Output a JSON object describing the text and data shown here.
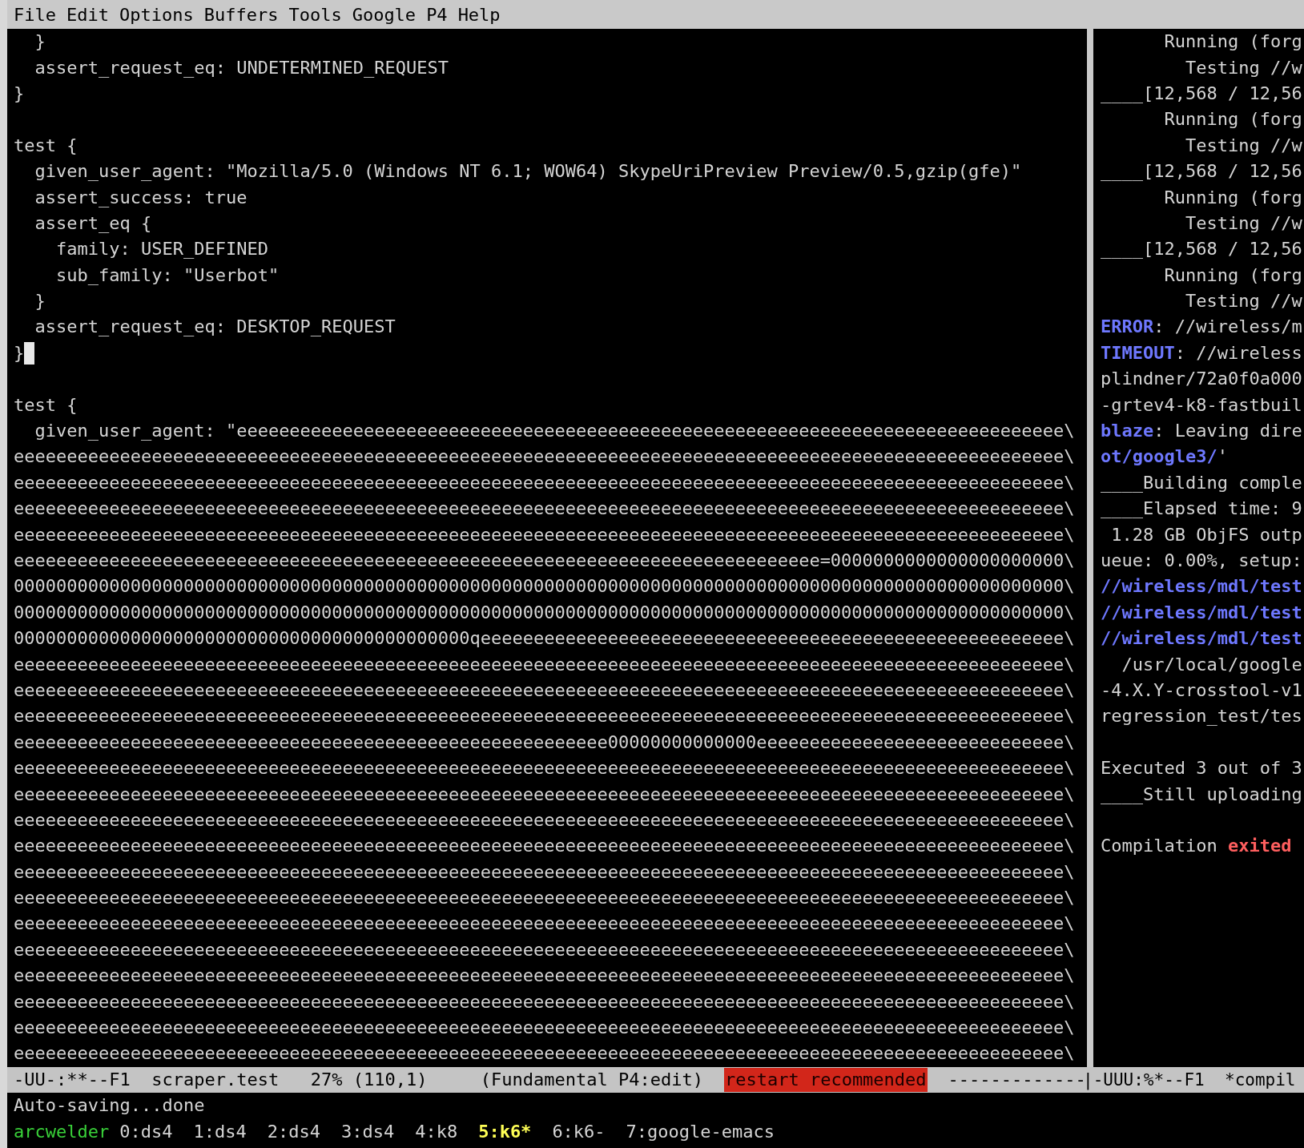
{
  "menu_bar": {
    "items": [
      "File",
      "Edit",
      "Options",
      "Buffers",
      "Tools",
      "Google",
      "P4",
      "Help"
    ]
  },
  "left_pane": {
    "lines": [
      {
        "kind": "code",
        "text": "  }",
        "cursor": false
      },
      {
        "kind": "code",
        "text": "  assert_request_eq: UNDETERMINED_REQUEST",
        "cursor": false
      },
      {
        "kind": "code",
        "text": "}",
        "cursor": false
      },
      {
        "kind": "blank"
      },
      {
        "kind": "code",
        "text": "test {",
        "cursor": false
      },
      {
        "kind": "code",
        "text": "  given_user_agent: \"Mozilla/5.0 (Windows NT 6.1; WOW64) SkypeUriPreview Preview/0.5,gzip(gfe)\"",
        "cursor": false
      },
      {
        "kind": "code",
        "text": "  assert_success: true",
        "cursor": false
      },
      {
        "kind": "code",
        "text": "  assert_eq {",
        "cursor": false
      },
      {
        "kind": "code",
        "text": "    family: USER_DEFINED",
        "cursor": false
      },
      {
        "kind": "code",
        "text": "    sub_family: \"Userbot\"",
        "cursor": false
      },
      {
        "kind": "code",
        "text": "  }",
        "cursor": false
      },
      {
        "kind": "code",
        "text": "  assert_request_eq: DESKTOP_REQUEST",
        "cursor": false
      },
      {
        "kind": "code",
        "text": "}",
        "cursor": true
      },
      {
        "kind": "blank"
      },
      {
        "kind": "code",
        "text": "test {",
        "cursor": false
      },
      {
        "kind": "code",
        "text": "  given_user_agent: \"eeeeeeeeeeeeeeeeeeeeeeeeeeeeeeeeeeeeeeeeeeeeeeeeeeeeeeeeeeeeeeeeeeeeeeeeeeeeee\\",
        "cursor": false
      },
      {
        "kind": "code",
        "text": "eeeeeeeeeeeeeeeeeeeeeeeeeeeeeeeeeeeeeeeeeeeeeeeeeeeeeeeeeeeeeeeeeeeeeeeeeeeeeeeeeeeeeeeeeeeeeeeeeee\\",
        "cursor": false
      },
      {
        "kind": "code",
        "text": "eeeeeeeeeeeeeeeeeeeeeeeeeeeeeeeeeeeeeeeeeeeeeeeeeeeeeeeeeeeeeeeeeeeeeeeeeeeeeeeeeeeeeeeeeeeeeeeeeee\\",
        "cursor": false
      },
      {
        "kind": "code",
        "text": "eeeeeeeeeeeeeeeeeeeeeeeeeeeeeeeeeeeeeeeeeeeeeeeeeeeeeeeeeeeeeeeeeeeeeeeeeeeeeeeeeeeeeeeeeeeeeeeeeee\\",
        "cursor": false
      },
      {
        "kind": "code",
        "text": "eeeeeeeeeeeeeeeeeeeeeeeeeeeeeeeeeeeeeeeeeeeeeeeeeeeeeeeeeeeeeeeeeeeeeeeeeeeeeeeeeeeeeeeeeeeeeeeeeee\\",
        "cursor": false
      },
      {
        "kind": "code",
        "text": "eeeeeeeeeeeeeeeeeeeeeeeeeeeeeeeeeeeeeeeeeeeeeeeeeeeeeeeeeeeeeeeeeeeeeeeeeeee=0000000000000000000000\\",
        "cursor": false
      },
      {
        "kind": "code",
        "text": "000000000000000000000000000000000000000000000000000000000000000000000000000000000000000000000000000\\",
        "cursor": false
      },
      {
        "kind": "code",
        "text": "000000000000000000000000000000000000000000000000000000000000000000000000000000000000000000000000000\\",
        "cursor": false
      },
      {
        "kind": "code",
        "text": "0000000000000000000000000000000000000000000qeeeeeeeeeeeeeeeeeeeeeeeeeeeeeeeeeeeeeeeeeeeeeeeeeeeeeee\\",
        "cursor": false
      },
      {
        "kind": "code",
        "text": "eeeeeeeeeeeeeeeeeeeeeeeeeeeeeeeeeeeeeeeeeeeeeeeeeeeeeeeeeeeeeeeeeeeeeeeeeeeeeeeeeeeeeeeeeeeeeeeeeee\\",
        "cursor": false
      },
      {
        "kind": "code",
        "text": "eeeeeeeeeeeeeeeeeeeeeeeeeeeeeeeeeeeeeeeeeeeeeeeeeeeeeeeeeeeeeeeeeeeeeeeeeeeeeeeeeeeeeeeeeeeeeeeeeee\\",
        "cursor": false
      },
      {
        "kind": "code",
        "text": "eeeeeeeeeeeeeeeeeeeeeeeeeeeeeeeeeeeeeeeeeeeeeeeeeeeeeeeeeeeeeeeeeeeeeeeeeeeeeeeeeeeeeeeeeeeeeeeeeee\\",
        "cursor": false
      },
      {
        "kind": "code",
        "text": "eeeeeeeeeeeeeeeeeeeeeeeeeeeeeeeeeeeeeeeeeeeeeeeeeeeeeeee00000000000000eeeeeeeeeeeeeeeeeeeeeeeeeeeee\\",
        "cursor": false
      },
      {
        "kind": "code",
        "text": "eeeeeeeeeeeeeeeeeeeeeeeeeeeeeeeeeeeeeeeeeeeeeeeeeeeeeeeeeeeeeeeeeeeeeeeeeeeeeeeeeeeeeeeeeeeeeeeeeee\\",
        "cursor": false
      },
      {
        "kind": "code",
        "text": "eeeeeeeeeeeeeeeeeeeeeeeeeeeeeeeeeeeeeeeeeeeeeeeeeeeeeeeeeeeeeeeeeeeeeeeeeeeeeeeeeeeeeeeeeeeeeeeeeee\\",
        "cursor": false
      },
      {
        "kind": "code",
        "text": "eeeeeeeeeeeeeeeeeeeeeeeeeeeeeeeeeeeeeeeeeeeeeeeeeeeeeeeeeeeeeeeeeeeeeeeeeeeeeeeeeeeeeeeeeeeeeeeeeee\\",
        "cursor": false
      },
      {
        "kind": "code",
        "text": "eeeeeeeeeeeeeeeeeeeeeeeeeeeeeeeeeeeeeeeeeeeeeeeeeeeeeeeeeeeeeeeeeeeeeeeeeeeeeeeeeeeeeeeeeeeeeeeeeee\\",
        "cursor": false
      },
      {
        "kind": "code",
        "text": "eeeeeeeeeeeeeeeeeeeeeeeeeeeeeeeeeeeeeeeeeeeeeeeeeeeeeeeeeeeeeeeeeeeeeeeeeeeeeeeeeeeeeeeeeeeeeeeeeee\\",
        "cursor": false
      },
      {
        "kind": "code",
        "text": "eeeeeeeeeeeeeeeeeeeeeeeeeeeeeeeeeeeeeeeeeeeeeeeeeeeeeeeeeeeeeeeeeeeeeeeeeeeeeeeeeeeeeeeeeeeeeeeeeee\\",
        "cursor": false
      },
      {
        "kind": "code",
        "text": "eeeeeeeeeeeeeeeeeeeeeeeeeeeeeeeeeeeeeeeeeeeeeeeeeeeeeeeeeeeeeeeeeeeeeeeeeeeeeeeeeeeeeeeeeeeeeeeeeee\\",
        "cursor": false
      },
      {
        "kind": "code",
        "text": "eeeeeeeeeeeeeeeeeeeeeeeeeeeeeeeeeeeeeeeeeeeeeeeeeeeeeeeeeeeeeeeeeeeeeeeeeeeeeeeeeeeeeeeeeeeeeeeeeee\\",
        "cursor": false
      },
      {
        "kind": "code",
        "text": "eeeeeeeeeeeeeeeeeeeeeeeeeeeeeeeeeeeeeeeeeeeeeeeeeeeeeeeeeeeeeeeeeeeeeeeeeeeeeeeeeeeeeeeeeeeeeeeeeee\\",
        "cursor": false
      },
      {
        "kind": "code",
        "text": "eeeeeeeeeeeeeeeeeeeeeeeeeeeeeeeeeeeeeeeeeeeeeeeeeeeeeeeeeeeeeeeeeeeeeeeeeeeeeeeeeeeeeeeeeeeeeeeeeee\\",
        "cursor": false
      },
      {
        "kind": "code",
        "text": "eeeeeeeeeeeeeeeeeeeeeeeeeeeeeeeeeeeeeeeeeeeeeeeeeeeeeeeeeeeeeeeeeeeeeeeeeeeeeeeeeeeeeeeeeeeeeeeeeee\\",
        "cursor": false
      },
      {
        "kind": "code",
        "text": "eeeeeeeeeeeeeeeeeeeeeeeeeeeeeeeeeeeeeeeeeeeeeeeeeeeeeeeeeeeeeeeeeeeeeeeeeeeeeeeeeeeeeeeeeeeeeeeeeee\\",
        "cursor": false
      }
    ]
  },
  "right_pane": {
    "lines": [
      {
        "kind": "output",
        "segments": [
          {
            "kind": "plain",
            "text": "      Running (forg"
          }
        ]
      },
      {
        "kind": "output",
        "segments": [
          {
            "kind": "plain",
            "text": "        Testing //w"
          }
        ]
      },
      {
        "kind": "output",
        "segments": [
          {
            "kind": "plain",
            "text": "____[12,568 / 12,56"
          }
        ]
      },
      {
        "kind": "output",
        "segments": [
          {
            "kind": "plain",
            "text": "      Running (forg"
          }
        ]
      },
      {
        "kind": "output",
        "segments": [
          {
            "kind": "plain",
            "text": "        Testing //w"
          }
        ]
      },
      {
        "kind": "output",
        "segments": [
          {
            "kind": "plain",
            "text": "____[12,568 / 12,56"
          }
        ]
      },
      {
        "kind": "output",
        "segments": [
          {
            "kind": "plain",
            "text": "      Running (forg"
          }
        ]
      },
      {
        "kind": "output",
        "segments": [
          {
            "kind": "plain",
            "text": "        Testing //w"
          }
        ]
      },
      {
        "kind": "output",
        "segments": [
          {
            "kind": "plain",
            "text": "____[12,568 / 12,56"
          }
        ]
      },
      {
        "kind": "output",
        "segments": [
          {
            "kind": "plain",
            "text": "      Running (forg"
          }
        ]
      },
      {
        "kind": "output",
        "segments": [
          {
            "kind": "plain",
            "text": "        Testing //w"
          }
        ]
      },
      {
        "kind": "output",
        "segments": [
          {
            "kind": "link",
            "text": "ERROR"
          },
          {
            "kind": "plain",
            "text": ": //wireless/m"
          }
        ]
      },
      {
        "kind": "output",
        "segments": [
          {
            "kind": "link",
            "text": "TIMEOUT"
          },
          {
            "kind": "plain",
            "text": ": //wireless"
          }
        ]
      },
      {
        "kind": "output",
        "segments": [
          {
            "kind": "plain",
            "text": "plindner/72a0f0a000"
          }
        ]
      },
      {
        "kind": "output",
        "segments": [
          {
            "kind": "plain",
            "text": "-grtev4-k8-fastbuil"
          }
        ]
      },
      {
        "kind": "output",
        "segments": [
          {
            "kind": "link",
            "text": "blaze"
          },
          {
            "kind": "plain",
            "text": ": Leaving dire"
          }
        ]
      },
      {
        "kind": "output",
        "segments": [
          {
            "kind": "link",
            "text": "ot/google3/"
          },
          {
            "kind": "plain",
            "text": "'"
          }
        ]
      },
      {
        "kind": "output",
        "segments": [
          {
            "kind": "plain",
            "text": "____Building comple"
          }
        ]
      },
      {
        "kind": "output",
        "segments": [
          {
            "kind": "plain",
            "text": "____Elapsed time: 9"
          }
        ]
      },
      {
        "kind": "output",
        "segments": [
          {
            "kind": "plain",
            "text": " 1.28 GB ObjFS outp"
          }
        ]
      },
      {
        "kind": "output",
        "segments": [
          {
            "kind": "plain",
            "text": "ueue: 0.00%, setup:"
          }
        ]
      },
      {
        "kind": "output",
        "segments": [
          {
            "kind": "link",
            "text": "//wireless/mdl/test"
          }
        ]
      },
      {
        "kind": "output",
        "segments": [
          {
            "kind": "link",
            "text": "//wireless/mdl/test"
          }
        ]
      },
      {
        "kind": "output",
        "segments": [
          {
            "kind": "link",
            "text": "//wireless/mdl/test"
          }
        ]
      },
      {
        "kind": "output",
        "segments": [
          {
            "kind": "plain",
            "text": "  /usr/local/google"
          }
        ]
      },
      {
        "kind": "output",
        "segments": [
          {
            "kind": "plain",
            "text": "-4.X.Y-crosstool-v1"
          }
        ]
      },
      {
        "kind": "output",
        "segments": [
          {
            "kind": "plain",
            "text": "regression_test/tes"
          }
        ]
      },
      {
        "kind": "blank"
      },
      {
        "kind": "output",
        "segments": [
          {
            "kind": "plain",
            "text": "Executed 3 out of 3"
          }
        ]
      },
      {
        "kind": "output",
        "segments": [
          {
            "kind": "plain",
            "text": "____Still uploading"
          }
        ]
      },
      {
        "kind": "blank"
      },
      {
        "kind": "output",
        "segments": [
          {
            "kind": "plain",
            "text": "Compilation "
          },
          {
            "kind": "alert",
            "text": "exited"
          }
        ]
      }
    ]
  },
  "mode_line": {
    "left_text": "-UU-:**--F1  scraper.test   27% (110,1)     (Fundamental P4:edit)",
    "warning": "restart recommended",
    "fill": "-------------",
    "right_text": "|-UUU:%*--F1  *compil"
  },
  "echo_area": {
    "message": "Auto-saving...done"
  },
  "tab_bar": {
    "session": "arcwelder",
    "tabs": [
      {
        "label": "0:ds4",
        "selected": false
      },
      {
        "label": "1:ds4",
        "selected": false
      },
      {
        "label": "2:ds4",
        "selected": false
      },
      {
        "label": "3:ds4",
        "selected": false
      },
      {
        "label": "4:k8",
        "selected": false
      },
      {
        "label": "5:k6*",
        "selected": true
      },
      {
        "label": "6:k6-",
        "selected": false
      },
      {
        "label": "7:google-emacs",
        "selected": false
      }
    ]
  }
}
